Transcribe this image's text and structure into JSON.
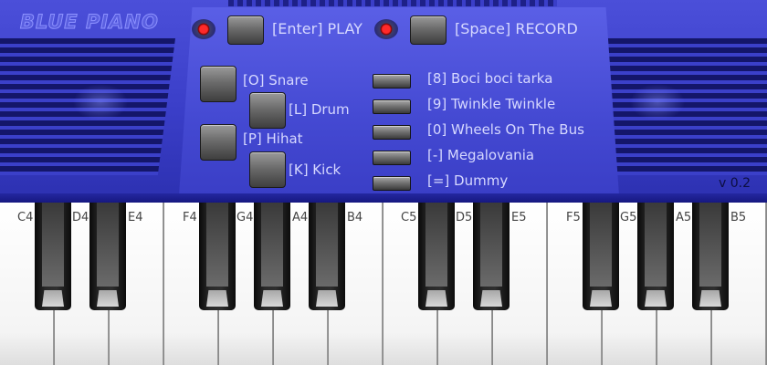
{
  "app": {
    "title": "BLUE PIANO",
    "version": "v 0.2"
  },
  "transport": {
    "play_label": "[Enter] PLAY",
    "record_label": "[Space] RECORD"
  },
  "drums": {
    "snare": "[O] Snare",
    "drum": "[L] Drum",
    "hihat": "[P] Hihat",
    "kick": "[K] Kick"
  },
  "songs": [
    "[8] Boci boci tarka",
    "[9] Twinkle Twinkle",
    "[0] Wheels On The Bus",
    "[-] Megalovania",
    "[=] Dummy"
  ],
  "keyboard": {
    "white_keys": [
      "C4",
      "D4",
      "E4",
      "F4",
      "G4",
      "A4",
      "B4",
      "C5",
      "D5",
      "E5",
      "F5",
      "G5",
      "A5",
      "B5"
    ]
  },
  "colors": {
    "panel": "#3a3ec8",
    "led_on": "#ff2a2a"
  }
}
